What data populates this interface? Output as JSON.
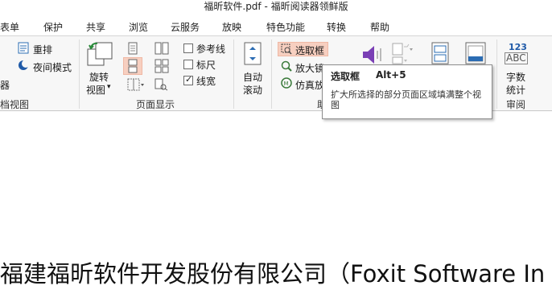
{
  "window": {
    "title": "福昕软件.pdf - 福昕阅读器领鲜版"
  },
  "menu": [
    {
      "label": "表单"
    },
    {
      "label": "保护"
    },
    {
      "label": "共享"
    },
    {
      "label": "浏览"
    },
    {
      "label": "云服务"
    },
    {
      "label": "放映"
    },
    {
      "label": "特色功能"
    },
    {
      "label": "转换"
    },
    {
      "label": "帮助"
    }
  ],
  "ribbon": {
    "doc_view": {
      "rearrange_label": "重排",
      "night_mode_label": "夜间模式",
      "partial_label": "器",
      "group_label": "档视图"
    },
    "page_display": {
      "rotate_label_1": "旋转",
      "rotate_label_2": "视图",
      "dropdown_arrow": "▾",
      "group_label": "页面显示"
    },
    "view_options": {
      "guides_label": "参考线",
      "ruler_label": "标尺",
      "line_weight_label": "线宽",
      "guides_checked": false,
      "ruler_checked": false,
      "line_weight_checked": true
    },
    "auto_scroll": {
      "label_1": "自动",
      "label_2": "滚动"
    },
    "assist": {
      "select_area_label": "选取框",
      "magnifier_label": "放大镜",
      "loupe_label": "仿真放",
      "group_label_partial": "助"
    },
    "review": {
      "abc_top": "123",
      "abc_bottom": "ABC",
      "word_count_1": "字数",
      "word_count_2": "统计",
      "group_label": "审阅"
    }
  },
  "tooltip": {
    "title": "选取框",
    "shortcut": "Alt+5",
    "description": "扩大所选择的部分页面区域填满整个视图"
  },
  "document": {
    "text": "福建福昕软件开发股份有限公司（Foxit Software In"
  }
}
